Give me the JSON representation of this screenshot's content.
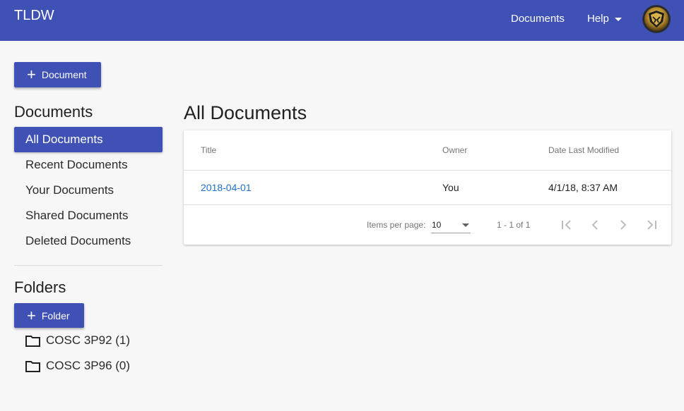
{
  "header": {
    "brand": "TLDW",
    "nav_documents": "Documents",
    "nav_help": "Help"
  },
  "sidebar": {
    "add_document_label": "Document",
    "documents_title": "Documents",
    "items": [
      {
        "label": "All Documents",
        "active": true
      },
      {
        "label": "Recent Documents",
        "active": false
      },
      {
        "label": "Your Documents",
        "active": false
      },
      {
        "label": "Shared Documents",
        "active": false
      },
      {
        "label": "Deleted Documents",
        "active": false
      }
    ],
    "folders_title": "Folders",
    "add_folder_label": "Folder",
    "folders": [
      {
        "label": "COSC 3P92 (1)"
      },
      {
        "label": "COSC 3P96 (0)"
      }
    ]
  },
  "main": {
    "title": "All Documents",
    "table": {
      "columns": [
        "Title",
        "Owner",
        "Date Last Modified"
      ],
      "rows": [
        {
          "title": "2018-04-01",
          "owner": "You",
          "modified": "4/1/18, 8:37 AM"
        }
      ]
    },
    "paginator": {
      "items_per_page_label": "Items per page:",
      "page_size": "10",
      "range": "1 - 1 of 1"
    }
  },
  "icons": {
    "add": "plus-icon",
    "folder": "folder-icon",
    "caret": "caret-down-icon",
    "first": "first-page-icon",
    "prev": "chevron-left-icon",
    "next": "chevron-right-icon",
    "last": "last-page-icon"
  },
  "colors": {
    "primary": "#3f51b5",
    "link": "#1e6fcf",
    "background": "#f7f7f7"
  }
}
